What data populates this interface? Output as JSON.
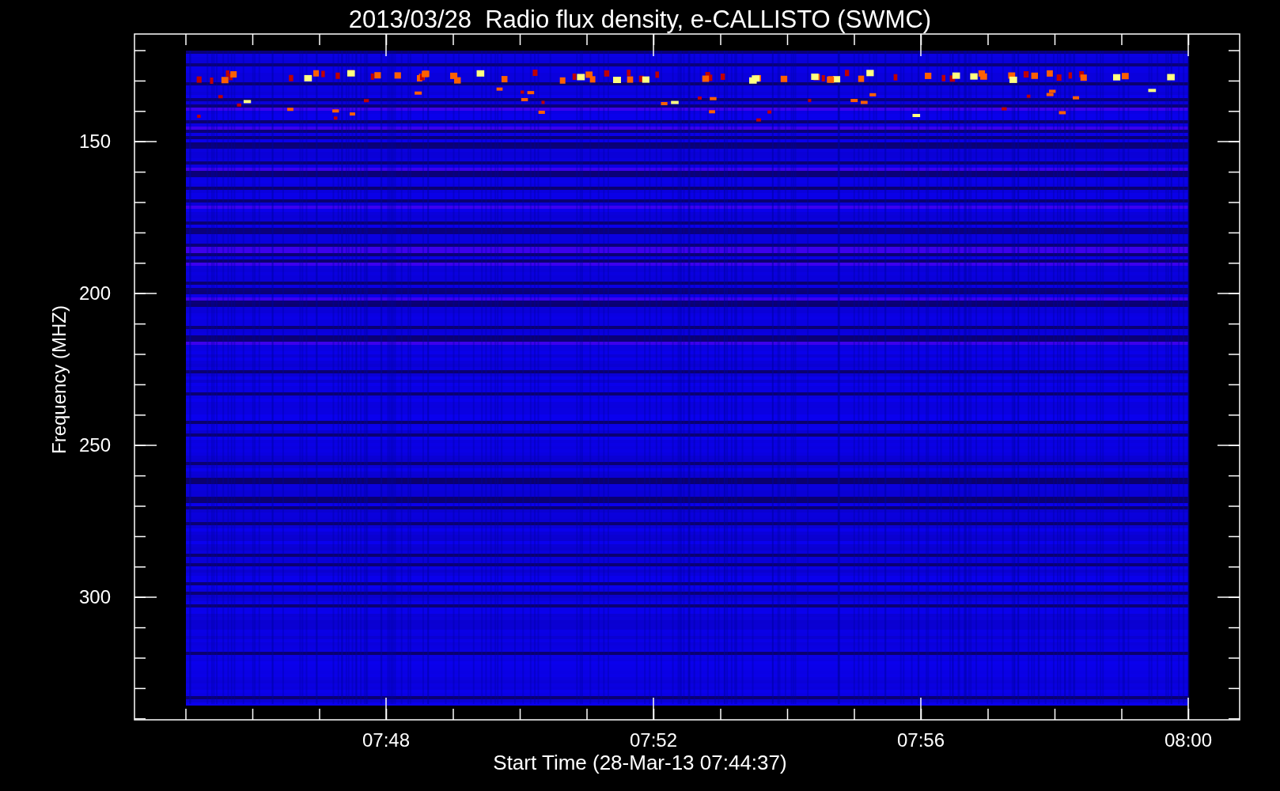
{
  "title": "2013/03/28  Radio flux density, e-CALLISTO (SWMC)",
  "y_axis": {
    "label": "Frequency (MHZ)",
    "ticks": [
      "150",
      "200",
      "250",
      "300"
    ]
  },
  "x_axis": {
    "label": "Start Time (28-Mar-13 07:44:37)",
    "ticks": [
      "07:48",
      "07:52",
      "07:56",
      "08:00"
    ]
  }
}
